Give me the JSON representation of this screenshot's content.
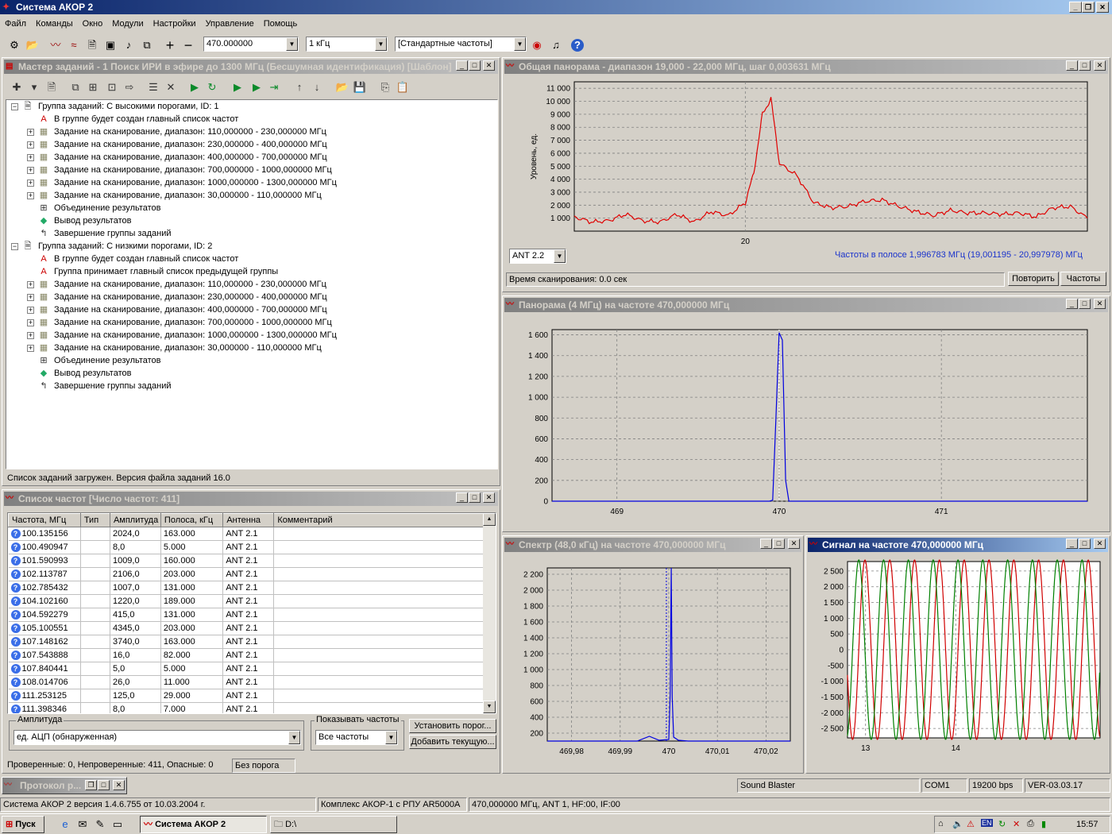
{
  "app": {
    "title": "Система АКОР 2"
  },
  "menu": [
    "Файл",
    "Команды",
    "Окно",
    "Модули",
    "Настройки",
    "Управление",
    "Помощь"
  ],
  "toolbar": {
    "freq_value": "470.000000",
    "step_value": "1 кГц",
    "freq_set_value": "[Стандартные частоты]"
  },
  "task_master": {
    "title": "Мастер заданий - 1 Поиск ИРИ в эфире до 1300 МГц (Бесшумная идентификация) [Шаблон]",
    "tree": [
      {
        "level": 0,
        "exp": "−",
        "icon": "page",
        "text": "Группа заданий: С высокими порогами, ID: 1"
      },
      {
        "level": 1,
        "exp": "",
        "icon": "A",
        "text": "В группе будет создан главный список частот"
      },
      {
        "level": 1,
        "exp": "+",
        "icon": "scan",
        "text": "Задание на сканирование, диапазон: 110,000000 - 230,000000 МГц"
      },
      {
        "level": 1,
        "exp": "+",
        "icon": "scan",
        "text": "Задание на сканирование, диапазон: 230,000000 - 400,000000 МГц"
      },
      {
        "level": 1,
        "exp": "+",
        "icon": "scan",
        "text": "Задание на сканирование, диапазон: 400,000000 - 700,000000 МГц"
      },
      {
        "level": 1,
        "exp": "+",
        "icon": "scan",
        "text": "Задание на сканирование, диапазон: 700,000000 - 1000,000000 МГц"
      },
      {
        "level": 1,
        "exp": "+",
        "icon": "scan",
        "text": "Задание на сканирование, диапазон: 1000,000000 - 1300,000000 МГц"
      },
      {
        "level": 1,
        "exp": "+",
        "icon": "scan",
        "text": "Задание на сканирование, диапазон: 30,000000 - 110,000000 МГц"
      },
      {
        "level": 1,
        "exp": "",
        "icon": "merge",
        "text": "Объединение результатов"
      },
      {
        "level": 1,
        "exp": "",
        "icon": "output",
        "text": "Вывод результатов"
      },
      {
        "level": 1,
        "exp": "",
        "icon": "end",
        "text": "Завершение группы заданий"
      },
      {
        "level": 0,
        "exp": "−",
        "icon": "page",
        "text": "Группа заданий: С низкими порогами, ID: 2"
      },
      {
        "level": 1,
        "exp": "",
        "icon": "A",
        "text": "В группе будет создан главный список частот"
      },
      {
        "level": 1,
        "exp": "",
        "icon": "A",
        "text": "Группа принимает главный список предыдущей группы"
      },
      {
        "level": 1,
        "exp": "+",
        "icon": "scan",
        "text": "Задание на сканирование, диапазон: 110,000000 - 230,000000 МГц"
      },
      {
        "level": 1,
        "exp": "+",
        "icon": "scan",
        "text": "Задание на сканирование, диапазон: 230,000000 - 400,000000 МГц"
      },
      {
        "level": 1,
        "exp": "+",
        "icon": "scan",
        "text": "Задание на сканирование, диапазон: 400,000000 - 700,000000 МГц"
      },
      {
        "level": 1,
        "exp": "+",
        "icon": "scan",
        "text": "Задание на сканирование, диапазон: 700,000000 - 1000,000000 МГц"
      },
      {
        "level": 1,
        "exp": "+",
        "icon": "scan",
        "text": "Задание на сканирование, диапазон: 1000,000000 - 1300,000000 МГц"
      },
      {
        "level": 1,
        "exp": "+",
        "icon": "scan",
        "text": "Задание на сканирование, диапазон: 30,000000 - 110,000000 МГц"
      },
      {
        "level": 1,
        "exp": "",
        "icon": "merge",
        "text": "Объединение результатов"
      },
      {
        "level": 1,
        "exp": "",
        "icon": "output",
        "text": "Вывод результатов"
      },
      {
        "level": 1,
        "exp": "",
        "icon": "end",
        "text": "Завершение группы заданий"
      }
    ],
    "status": "Список заданий загружен. Версия файла заданий 16.0"
  },
  "freq_list": {
    "title": "Список частот [Число частот: 411]",
    "columns": [
      "Частота, МГц",
      "Тип",
      "Амплитуда",
      "Полоса, кГц",
      "Антенна",
      "Комментарий"
    ],
    "rows": [
      [
        "100.135156",
        "",
        "2024,0",
        "163.000",
        "ANT 2.1",
        ""
      ],
      [
        "100.490947",
        "",
        "8,0",
        "5.000",
        "ANT 2.1",
        ""
      ],
      [
        "101.590993",
        "",
        "1009,0",
        "160.000",
        "ANT 2.1",
        ""
      ],
      [
        "102.113787",
        "",
        "2106,0",
        "203.000",
        "ANT 2.1",
        ""
      ],
      [
        "102.785432",
        "",
        "1007,0",
        "131.000",
        "ANT 2.1",
        ""
      ],
      [
        "104.102160",
        "",
        "1220,0",
        "189.000",
        "ANT 2.1",
        ""
      ],
      [
        "104.592279",
        "",
        "415,0",
        "131.000",
        "ANT 2.1",
        ""
      ],
      [
        "105.100551",
        "",
        "4345,0",
        "203.000",
        "ANT 2.1",
        ""
      ],
      [
        "107.148162",
        "",
        "3740,0",
        "163.000",
        "ANT 2.1",
        ""
      ],
      [
        "107.543888",
        "",
        "16,0",
        "82.000",
        "ANT 2.1",
        ""
      ],
      [
        "107.840441",
        "",
        "5,0",
        "5.000",
        "ANT 2.1",
        ""
      ],
      [
        "108.014706",
        "",
        "26,0",
        "11.000",
        "ANT 2.1",
        ""
      ],
      [
        "111.253125",
        "",
        "125,0",
        "29.000",
        "ANT 2.1",
        ""
      ],
      [
        "111.398346",
        "",
        "8,0",
        "7.000",
        "ANT 2.1",
        ""
      ]
    ],
    "amplitude_label": "Амплитуда",
    "amplitude_value": "ед. АЦП (обнаруженная)",
    "show_label": "Показывать частоты",
    "show_value": "Все частоты",
    "btn_threshold": "Установить порог...",
    "btn_add": "Добавить текущую...",
    "status_checked": "Проверенные: 0, Непроверенные: 411, Опасные: 0",
    "status_threshold": "Без порога"
  },
  "protocol": {
    "title": "Протокол р..."
  },
  "panorama": {
    "title": "Общая панорама - диапазон 19,000 - 22,000 МГц, шаг 0,003631 МГц",
    "ylabel": "Уровень, ед.",
    "antenna": "ANT 2.2",
    "band_info": "Частоты в полосе 1,996783 МГц (19,001195 - 20,997978) МГц",
    "scan_time": "Время сканирования: 0.0 сек",
    "btn_repeat": "Повторить",
    "btn_freqs": "Частоты"
  },
  "panorama4": {
    "title": "Панорама (4 МГц) на частоте 470,000000 МГц"
  },
  "spectrum": {
    "title": "Спектр (48,0 кГц)  на частоте 470,000000 МГц"
  },
  "signal": {
    "title": "Сигнал на частоте 470,000000 МГц"
  },
  "bottom_status": {
    "device": "Sound Blaster",
    "port": "COM1",
    "baud": "19200 bps",
    "ver": "VER-03.03.17"
  },
  "main_status": {
    "version": "Система АКОР 2 версия 1.4.6.755 от 10.03.2004 г.",
    "complex": "Комплекс АКОР-1 с РПУ AR5000A",
    "freq": "470,000000 МГц, ANT 1, HF:00, IF:00"
  },
  "taskbar": {
    "start": "Пуск",
    "task1": "Система АКОР 2",
    "task2": "D:\\",
    "clock": "15:57",
    "lang": "EN"
  },
  "chart_data": [
    {
      "type": "line",
      "chart": "panorama-overview",
      "xlim": [
        19.0,
        22.0
      ],
      "ylim": [
        0,
        11500
      ],
      "xticks": [
        20
      ],
      "ytick_labels": [
        "1 000",
        "2 000",
        "3 000",
        "4 000",
        "5 000",
        "6 000",
        "7 000",
        "8 000",
        "9 000",
        "10 000",
        "11 000"
      ],
      "grid": true,
      "color": "#e00000",
      "x": [
        19.0,
        19.1,
        19.2,
        19.3,
        19.4,
        19.5,
        19.6,
        19.7,
        19.8,
        19.9,
        20.0,
        20.05,
        20.1,
        20.15,
        20.2,
        20.3,
        20.4,
        20.5,
        20.6,
        20.7,
        20.8,
        20.9,
        21.0,
        21.1,
        21.2,
        21.3,
        21.4,
        21.5,
        21.6,
        21.7,
        21.8,
        21.9,
        22.0
      ],
      "y": [
        1100,
        700,
        800,
        1300,
        800,
        700,
        1300,
        700,
        1500,
        1200,
        2200,
        4500,
        9000,
        10200,
        5200,
        4300,
        2200,
        1800,
        1900,
        2300,
        2400,
        1900,
        1500,
        1200,
        1600,
        1400,
        1400,
        1300,
        1400,
        1100,
        1800,
        1900,
        1000
      ]
    },
    {
      "type": "line",
      "chart": "panorama-4mhz",
      "xlim": [
        468.6,
        471.9
      ],
      "ylim": [
        0,
        1650
      ],
      "xticks": [
        469,
        470,
        471
      ],
      "ytick_labels": [
        "0",
        "200",
        "400",
        "600",
        "800",
        "1 000",
        "1 200",
        "1 400",
        "1 600"
      ],
      "grid": true,
      "color": "#0000e0",
      "x": [
        468.6,
        469.94,
        469.96,
        469.98,
        470.0,
        470.02,
        470.04,
        470.06,
        471.9
      ],
      "y": [
        0,
        0,
        10,
        800,
        1620,
        1550,
        200,
        0,
        0
      ]
    },
    {
      "type": "line",
      "chart": "spectrum",
      "xlim": [
        469.975,
        470.025
      ],
      "ylim": [
        100,
        2280
      ],
      "xtick_labels": [
        "469,98",
        "469,99",
        "470",
        "470,01",
        "470,02"
      ],
      "ytick_labels": [
        "200",
        "400",
        "600",
        "800",
        "1 000",
        "1 200",
        "1 400",
        "1 600",
        "1 800",
        "2 000",
        "2 200"
      ],
      "grid": true,
      "color": "#0000e0",
      "x": [
        469.975,
        469.9935,
        469.996,
        469.998,
        470.0,
        470.0003,
        470.0005,
        470.0007,
        470.001,
        470.002,
        470.004,
        470.025
      ],
      "y": [
        100,
        100,
        160,
        110,
        120,
        700,
        2280,
        650,
        150,
        110,
        100,
        100
      ]
    },
    {
      "type": "line",
      "chart": "signal",
      "xlim": [
        12.8,
        15.6
      ],
      "ylim": [
        -2800,
        2800
      ],
      "xtick_labels": [
        "13",
        "14"
      ],
      "ytick_labels": [
        "2 500",
        "2 000",
        "1 500",
        "1 000",
        "500",
        "0",
        "-500",
        "-1 000",
        "-1 500",
        "-2 000",
        "-2 500"
      ],
      "grid": true,
      "series": [
        {
          "color": "#d00000",
          "amplitude": 2850,
          "period": 0.275,
          "phase": 0.0
        },
        {
          "color": "#008000",
          "amplitude": 2850,
          "period": 0.275,
          "phase": 1.57
        }
      ]
    }
  ]
}
